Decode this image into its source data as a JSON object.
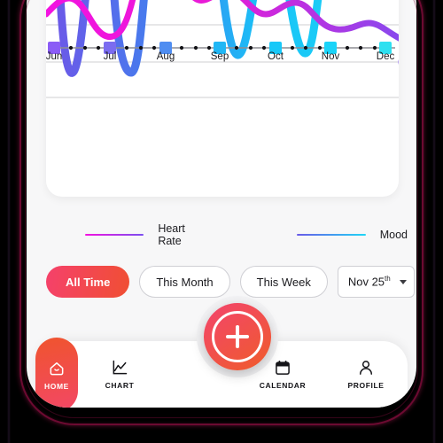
{
  "app": {
    "background_color": "#f7f7f8",
    "frame_color": "#000000",
    "accent_gradient_start": "#f5416b",
    "accent_gradient_end": "#f04f33"
  },
  "chart_card": {
    "marker_line_color": "#f4756e",
    "gridline_color": "#cfcfd2"
  },
  "chart_data": {
    "type": "line",
    "title": "",
    "xlabel": "",
    "ylabel": "",
    "grid": true,
    "legend_position": "below",
    "x_tick_labels": [
      "Jun",
      "Jul",
      "Aug",
      "Sep",
      "Oct",
      "Nov",
      "Dec"
    ],
    "x_axis_marker_colors": [
      "#8b5cf6",
      "#7b6cf0",
      "#5b8cf0",
      "#28aef2",
      "#18c8f8",
      "#1ad3f8",
      "#2ee0f0"
    ],
    "series": [
      {
        "name": "Heart Rate",
        "color_start": "#f312e0",
        "color_end": "#7b4ff0",
        "points": [
          [
            0,
            52
          ],
          [
            14,
            44
          ],
          [
            28,
            52
          ],
          [
            42,
            74
          ],
          [
            56,
            82
          ],
          [
            70,
            66
          ],
          [
            84,
            40
          ],
          [
            98,
            12
          ],
          [
            112,
            4
          ],
          [
            126,
            22
          ],
          [
            140,
            48
          ],
          [
            154,
            66
          ],
          [
            168,
            72
          ],
          [
            182,
            70
          ],
          [
            196,
            58
          ],
          [
            210,
            46
          ],
          [
            224,
            48
          ],
          [
            238,
            62
          ],
          [
            252,
            76
          ],
          [
            266,
            86
          ],
          [
            280,
            90
          ],
          [
            294,
            84
          ],
          [
            308,
            72
          ],
          [
            322,
            64
          ],
          [
            336,
            62
          ],
          [
            350,
            70
          ],
          [
            364,
            80
          ],
          [
            378,
            84
          ],
          [
            392,
            76
          ],
          [
            406,
            56
          ],
          [
            420,
            34
          ],
          [
            428,
            22
          ]
        ]
      },
      {
        "name": "Mood",
        "color_start": "#6a5ae8",
        "color_end": "#1fd6f6",
        "points": [
          [
            0,
            96
          ],
          [
            8,
            60
          ],
          [
            16,
            18
          ],
          [
            24,
            2
          ],
          [
            32,
            10
          ],
          [
            40,
            44
          ],
          [
            48,
            80
          ],
          [
            56,
            96
          ],
          [
            64,
            88
          ],
          [
            72,
            56
          ],
          [
            80,
            18
          ],
          [
            88,
            2
          ],
          [
            96,
            14
          ],
          [
            104,
            52
          ],
          [
            112,
            88
          ],
          [
            120,
            98
          ],
          [
            128,
            92
          ],
          [
            136,
            66
          ],
          [
            150,
            36
          ],
          [
            164,
            12
          ],
          [
            178,
            4
          ],
          [
            192,
            16
          ],
          [
            206,
            48
          ],
          [
            220,
            78
          ],
          [
            234,
            94
          ],
          [
            248,
            88
          ],
          [
            262,
            60
          ],
          [
            276,
            26
          ],
          [
            290,
            6
          ],
          [
            304,
            2
          ],
          [
            318,
            10
          ],
          [
            332,
            22
          ],
          [
            346,
            24
          ],
          [
            360,
            22
          ],
          [
            374,
            22
          ],
          [
            384,
            22
          ],
          [
            396,
            14
          ],
          [
            406,
            0
          ]
        ]
      }
    ],
    "end_point": {
      "series": "Heart Rate",
      "color": "#8b5cf6",
      "marker": "filled-circle"
    }
  },
  "legend": {
    "items": [
      {
        "label": "Heart Rate",
        "color_start": "#f312e0",
        "color_end": "#7b4ff0"
      },
      {
        "label": "Mood",
        "color_start": "#6a5ae8",
        "color_end": "#1fd6f6"
      }
    ]
  },
  "filters": {
    "items": [
      {
        "label": "All Time",
        "active": true
      },
      {
        "label": "This Month",
        "active": false
      },
      {
        "label": "This Week",
        "active": false
      }
    ],
    "date_picker": {
      "month": "Nov",
      "day": "25",
      "ordinal_suffix": "th",
      "icon": "chevron-down-icon"
    }
  },
  "bottom_nav": {
    "items": [
      {
        "label": "HOME",
        "icon": "home-icon",
        "active": true
      },
      {
        "label": "CHART",
        "icon": "chart-icon",
        "active": false
      },
      {
        "label": "CALENDAR",
        "icon": "calendar-icon",
        "active": false
      },
      {
        "label": "PROFILE",
        "icon": "profile-icon",
        "active": false
      }
    ],
    "fab": {
      "icon": "plus-icon",
      "label": ""
    }
  }
}
